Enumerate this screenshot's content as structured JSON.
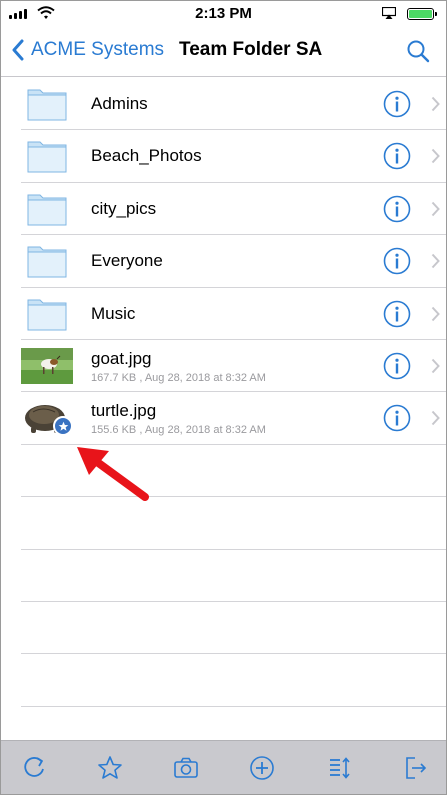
{
  "status_bar": {
    "time": "2:13 PM",
    "battery_color": "#4cd964"
  },
  "nav": {
    "back_label": "ACME Systems",
    "title": "Team Folder SA",
    "accent_color": "#2a7bd2",
    "search_icon": "search-icon"
  },
  "files": [
    {
      "name": "Admins",
      "type": "folder"
    },
    {
      "name": "Beach_Photos",
      "type": "folder"
    },
    {
      "name": "city_pics",
      "type": "folder"
    },
    {
      "name": "Everyone",
      "type": "folder"
    },
    {
      "name": "Music",
      "type": "folder"
    },
    {
      "name": "goat.jpg",
      "type": "image",
      "meta": "167.7 KB , Aug 28, 2018 at 8:32 AM"
    },
    {
      "name": "turtle.jpg",
      "type": "image",
      "meta": "155.6 KB , Aug 28, 2018 at 8:32 AM",
      "favorite": true
    }
  ],
  "toolbar": {
    "items": [
      "refresh-icon",
      "star-icon",
      "camera-icon",
      "add-icon",
      "sort-icon",
      "exit-icon"
    ]
  }
}
